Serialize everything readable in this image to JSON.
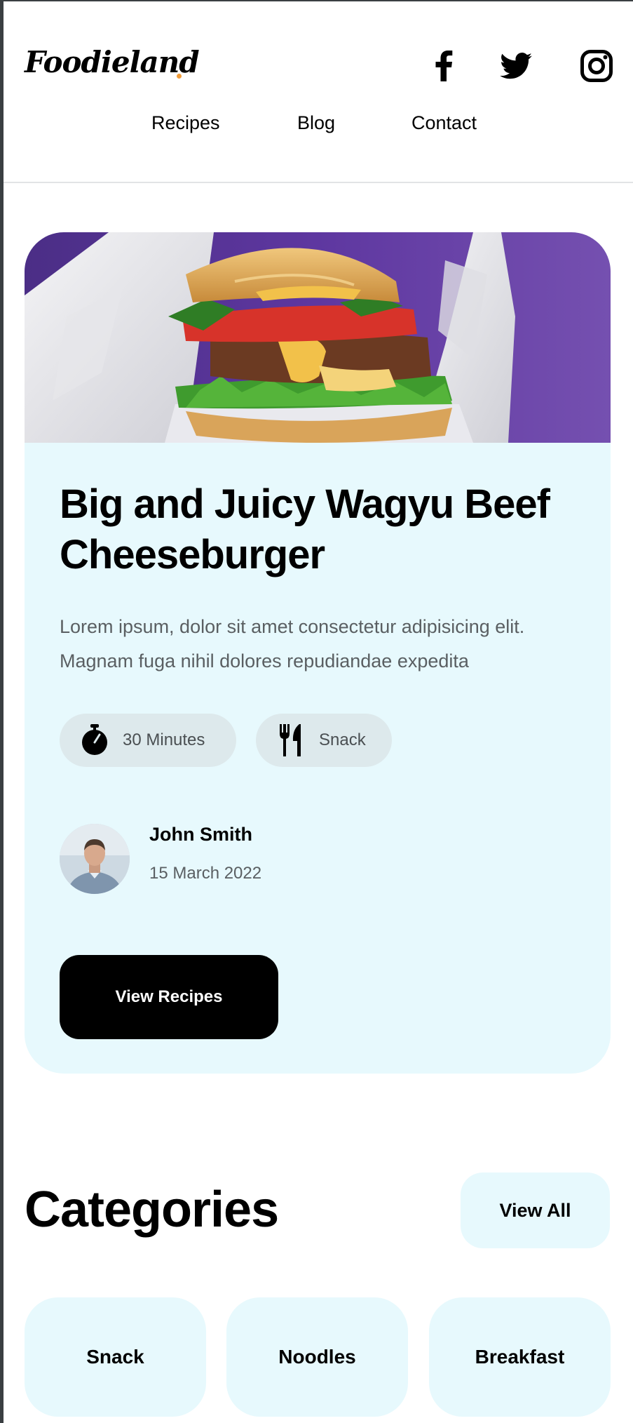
{
  "header": {
    "logo": "Foodieland",
    "social": [
      {
        "icon": "facebook-icon"
      },
      {
        "icon": "twitter-icon"
      },
      {
        "icon": "instagram-icon"
      }
    ],
    "nav": [
      {
        "label": "Recipes"
      },
      {
        "label": "Blog"
      },
      {
        "label": "Contact"
      }
    ]
  },
  "hero": {
    "image_alt_icon": "burger-image",
    "title": "Big and Juicy Wagyu Beef Cheeseburger",
    "description": "Lorem ipsum, dolor sit amet consectetur adipisicing elit. Magnam fuga nihil dolores repudiandae expedita",
    "time": {
      "icon": "timer-icon",
      "label": "30 Minutes"
    },
    "category": {
      "icon": "fork-knife-icon",
      "label": "Snack"
    },
    "author": {
      "name": "John Smith",
      "date": "15 March 2022"
    },
    "cta_label": "View Recipes"
  },
  "categories": {
    "title": "Categories",
    "view_all_label": "View All",
    "items": [
      {
        "label": "Snack"
      },
      {
        "label": "Noodles"
      },
      {
        "label": "Breakfast"
      }
    ]
  },
  "colors": {
    "accent": "#f29c38",
    "hero_bg": "#e7f9fd",
    "pill_bg": "#dde9ec",
    "cta_bg": "#000000",
    "image_bg": "#6e44a8"
  }
}
